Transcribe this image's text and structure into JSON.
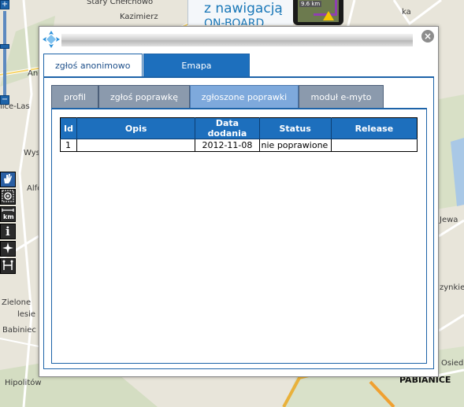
{
  "map": {
    "labels": [
      "Stary Chełchowo",
      "Kazimierz",
      "Alfo",
      "Ani",
      "Wys",
      "lice-Las",
      "Babiniec",
      "Zielone",
      "lesie",
      "Hipolitów",
      "PABIANICE",
      "Osied",
      "zynkie",
      "Jewa",
      "ka"
    ],
    "ad": {
      "line1": "z nawigacją",
      "line2": "ON-BOARD",
      "distance": "9.6 km"
    }
  },
  "zoom": {
    "plus": "+",
    "minus": "−"
  },
  "tools": {
    "colors": {
      "default": "#2b2b2b",
      "active": "#2a5fa3"
    },
    "items": [
      {
        "name": "pan-hand-icon",
        "active": true
      },
      {
        "name": "zoom-area-icon",
        "active": false
      },
      {
        "name": "measure-km-icon",
        "active": false,
        "text": "km"
      },
      {
        "name": "info-icon",
        "active": false,
        "text": "i"
      },
      {
        "name": "route-star-icon",
        "active": false
      },
      {
        "name": "route-points-icon",
        "active": false
      }
    ]
  },
  "dialog": {
    "close": "×",
    "top_tabs": [
      {
        "label": "zgłoś anonimowo",
        "active": false
      },
      {
        "label": "Emapa",
        "active": true
      }
    ],
    "sub_tabs": [
      {
        "label": "profil",
        "active": false
      },
      {
        "label": "zgłoś poprawkę",
        "active": false
      },
      {
        "label": "zgłoszone poprawki",
        "active": true
      },
      {
        "label": "moduł e-myto",
        "active": false
      }
    ],
    "table": {
      "columns": [
        "Id",
        "Opis",
        "Data dodania",
        "Status",
        "Release"
      ],
      "rows": [
        {
          "id": "1",
          "opis": "",
          "data": "2012-11-08",
          "status": "nie poprawione",
          "release": ""
        }
      ]
    }
  },
  "colors": {
    "accent": "#1d6fbd",
    "subtab": "#8b9aad",
    "subtab_active": "#7ea9dc",
    "map_bg": "#e8e5da"
  }
}
